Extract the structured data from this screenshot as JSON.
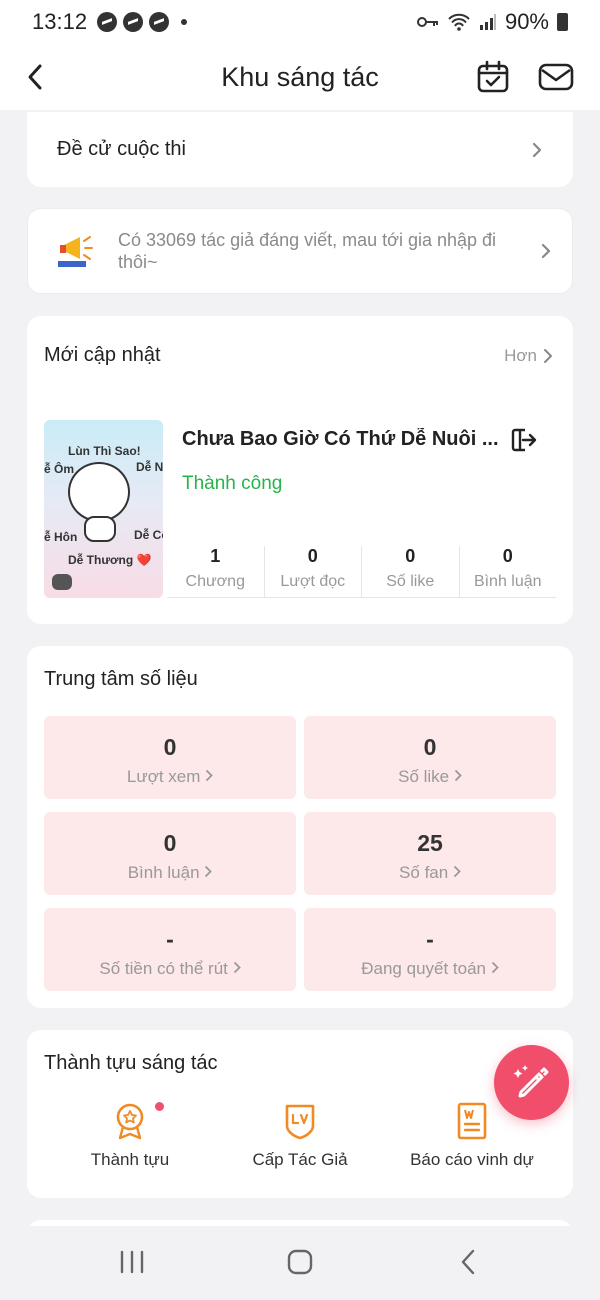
{
  "status_bar": {
    "time": "13:12",
    "battery": "90%"
  },
  "header": {
    "title": "Khu sáng tác"
  },
  "contest": {
    "label": "Đề cử cuộc thi"
  },
  "announcement": {
    "text": "Có 33069 tác giả đáng viết, mau tới gia nhập đi thôi~"
  },
  "updates": {
    "title": "Mới cập nhật",
    "more_label": "Hơn",
    "book": {
      "title": "Chưa Bao Giờ Có Thứ Dễ Nuôi ...",
      "status": "Thành công",
      "cover_text": {
        "top": "Lùn Thì Sao!",
        "left1": "ễ Ôm",
        "right1": "Dễ N",
        "left2": "ễ Hôn",
        "right2": "Dễ Cõ",
        "bottom": "Dễ Thương ❤️"
      },
      "stats": [
        {
          "value": "1",
          "label": "Chương"
        },
        {
          "value": "0",
          "label": "Lượt đọc"
        },
        {
          "value": "0",
          "label": "Số like"
        },
        {
          "value": "0",
          "label": "Bình luận"
        }
      ]
    }
  },
  "data_center": {
    "title": "Trung tâm số liệu",
    "tiles": [
      {
        "value": "0",
        "label": "Lượt xem"
      },
      {
        "value": "0",
        "label": "Số like"
      },
      {
        "value": "0",
        "label": "Bình luận"
      },
      {
        "value": "25",
        "label": "Số fan"
      },
      {
        "value": "-",
        "label": "Số tiền có thể rút"
      },
      {
        "value": "-",
        "label": "Đang quyết toán"
      }
    ]
  },
  "achievements": {
    "title": "Thành tựu sáng tác",
    "items": [
      {
        "label": "Thành tựu"
      },
      {
        "label": "Cấp Tác Giả"
      },
      {
        "label": "Báo cáo vinh dự"
      }
    ]
  },
  "colors": {
    "accent": "#f04e6a",
    "success": "#27b44b",
    "tile_bg": "#fde8ea",
    "icon_orange": "#f08a24"
  }
}
